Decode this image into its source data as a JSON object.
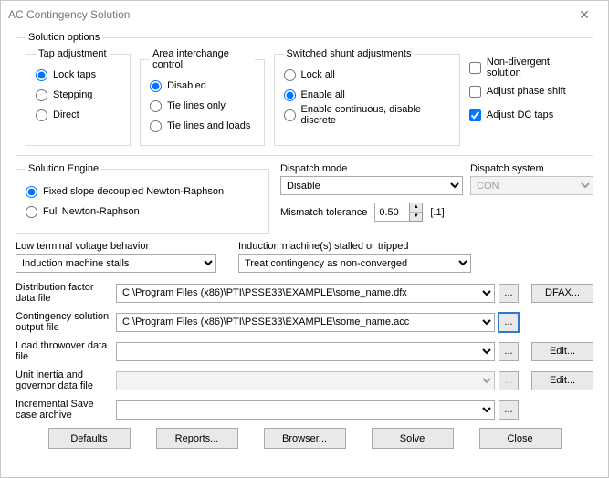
{
  "window": {
    "title": "AC Contingency Solution",
    "close": "✕"
  },
  "solutionOptions": {
    "legend": "Solution options",
    "tap": {
      "legend": "Tap adjustment",
      "lock": "Lock taps",
      "stepping": "Stepping",
      "direct": "Direct"
    },
    "area": {
      "legend": "Area interchange control",
      "disabled": "Disabled",
      "tieOnly": "Tie lines only",
      "tieLoads": "Tie lines and loads"
    },
    "shunt": {
      "legend": "Switched shunt adjustments",
      "lockAll": "Lock all",
      "enableAll": "Enable all",
      "cont": "Enable continuous, disable discrete"
    },
    "checks": {
      "nondiv": "Non-divergent solution",
      "phase": "Adjust phase shift",
      "dctaps": "Adjust DC taps"
    }
  },
  "engine": {
    "legend": "Solution Engine",
    "fixed": "Fixed slope decoupled Newton-Raphson",
    "full": "Full Newton-Raphson"
  },
  "dispatch": {
    "modeLabel": "Dispatch mode",
    "modeValue": "Disable",
    "systemLabel": "Dispatch system",
    "systemValue": "CON",
    "mismatchLabel": "Mismatch tolerance",
    "mismatchValue": "0.50",
    "mismatchSuffix": "[.1]"
  },
  "combos": {
    "lowVoltLabel": "Low terminal voltage behavior",
    "lowVoltValue": "Induction machine stalls",
    "stalledLabel": "Induction machine(s) stalled or tripped",
    "stalledValue": "Treat contingency as non-converged"
  },
  "files": {
    "dfx": {
      "label": "Distribution factor data file",
      "value": "C:\\Program Files (x86)\\PTI\\PSSE33\\EXAMPLE\\some_name.dfx",
      "btn": "DFAX..."
    },
    "acc": {
      "label": "Contingency solution output file",
      "value": "C:\\Program Files (x86)\\PTI\\PSSE33\\EXAMPLE\\some_name.acc"
    },
    "throw": {
      "label": "Load throwover data file",
      "value": "",
      "btn": "Edit..."
    },
    "inertia": {
      "label": "Unit inertia and governor data file",
      "value": "",
      "btn": "Edit..."
    },
    "incr": {
      "label": "Incremental Save case archive",
      "value": ""
    },
    "browse": "..."
  },
  "buttons": {
    "defaults": "Defaults",
    "reports": "Reports...",
    "browser": "Browser...",
    "solve": "Solve",
    "close": "Close"
  }
}
